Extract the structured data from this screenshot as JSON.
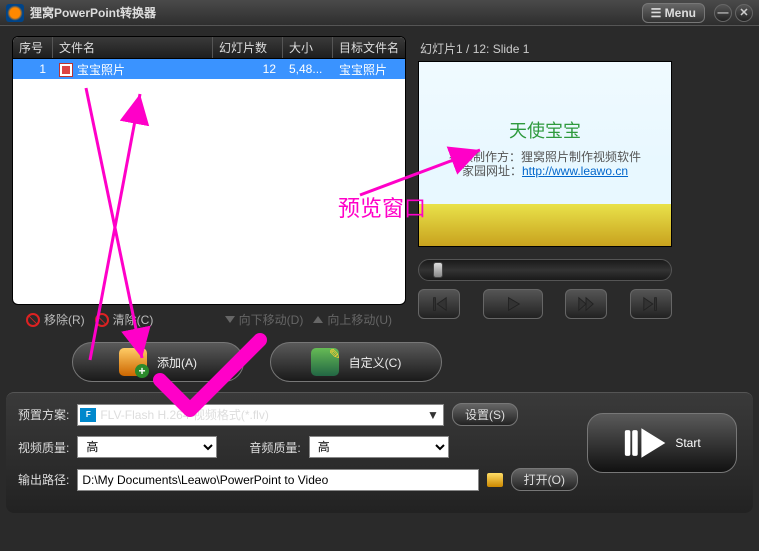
{
  "title": "狸窝PowerPoint转换器",
  "menu": "Menu",
  "columns": {
    "seq": "序号",
    "name": "文件名",
    "slides": "幻灯片数",
    "size": "大小",
    "target": "目标文件名"
  },
  "row": {
    "seq": "1",
    "name": "宝宝照片",
    "slides": "12",
    "size": "5,48...",
    "target": "宝宝照片"
  },
  "toolbar": {
    "remove": "移除(R)",
    "clear": "清除(C)",
    "movedown": "向下移动(D)",
    "moveup": "向上移动(U)"
  },
  "mid": {
    "add": "添加(A)",
    "custom": "自定义(C)"
  },
  "preview": {
    "label": "幻灯片1 / 12: Slide 1",
    "title": "天使宝宝",
    "sub1": "视频制作方：狸窝照片制作视频软件",
    "sub2_prefix": "家园网址：",
    "sub2_link": "http://www.leawo.cn"
  },
  "form": {
    "profile_lbl": "预置方案:",
    "profile_val": "FLV-Flash H.264 视频格式(*.flv)",
    "settings": "设置(S)",
    "vq_lbl": "视频质量:",
    "vq_val": "高",
    "aq_lbl": "音频质量:",
    "aq_val": "高",
    "out_lbl": "输出路径:",
    "out_val": "D:\\My Documents\\Leawo\\PowerPoint to Video",
    "open": "打开(O)"
  },
  "start": "Start",
  "annot": {
    "preview": "预览窗口"
  }
}
